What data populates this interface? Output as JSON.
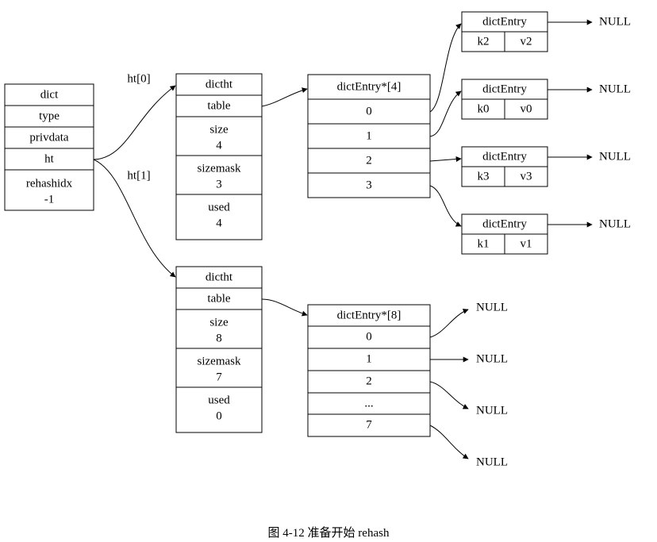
{
  "dict": {
    "title": "dict",
    "fields": [
      "type",
      "privdata",
      "ht"
    ],
    "rehashidx_label": "rehashidx",
    "rehashidx_value": "-1"
  },
  "ht_labels": {
    "ht0": "ht[0]",
    "ht1": "ht[1]"
  },
  "dictht0": {
    "title": "dictht",
    "table_label": "table",
    "size_label": "size",
    "size_value": "4",
    "sizemask_label": "sizemask",
    "sizemask_value": "3",
    "used_label": "used",
    "used_value": "4"
  },
  "dictht1": {
    "title": "dictht",
    "table_label": "table",
    "size_label": "size",
    "size_value": "8",
    "sizemask_label": "sizemask",
    "sizemask_value": "7",
    "used_label": "used",
    "used_value": "0"
  },
  "bucket0": {
    "title": "dictEntry*[4]",
    "slots": [
      "0",
      "1",
      "2",
      "3"
    ]
  },
  "bucket1": {
    "title": "dictEntry*[8]",
    "slots": [
      "0",
      "1",
      "2",
      "...",
      "7"
    ]
  },
  "entries": [
    {
      "title": "dictEntry",
      "k": "k2",
      "v": "v2"
    },
    {
      "title": "dictEntry",
      "k": "k0",
      "v": "v0"
    },
    {
      "title": "dictEntry",
      "k": "k3",
      "v": "v3"
    },
    {
      "title": "dictEntry",
      "k": "k1",
      "v": "v1"
    }
  ],
  "null_label": "NULL",
  "caption": "图 4-12    准备开始 rehash"
}
